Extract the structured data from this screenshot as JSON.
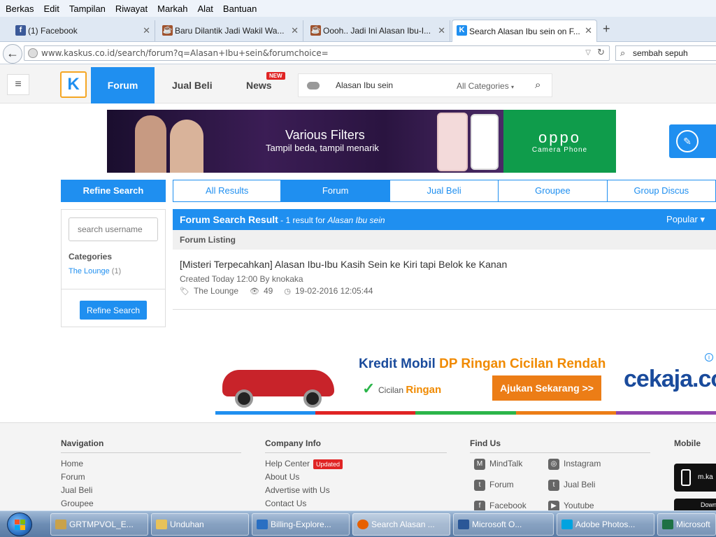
{
  "menu": [
    "Berkas",
    "Edit",
    "Tampilan",
    "Riwayat",
    "Markah",
    "Alat",
    "Bantuan"
  ],
  "tabs": [
    {
      "label": "(1) Facebook",
      "icon": "facebook-icon",
      "color": "#3b5998"
    },
    {
      "label": "Baru Dilantik Jadi Wakil Wa...",
      "icon": "coffee-icon",
      "color": "#a0522d"
    },
    {
      "label": "Oooh.. Jadi Ini Alasan Ibu-I...",
      "icon": "coffee-icon",
      "color": "#a0522d"
    },
    {
      "label": "Search Alasan Ibu sein on F...",
      "icon": "kaskus-icon",
      "color": "#1f8ff0"
    }
  ],
  "newtab": "+",
  "url": "www.kaskus.co.id/search/forum?q=Alasan+Ibu+sein&forumchoice=",
  "browser_search": "sembah sepuh",
  "header": {
    "logo": "K",
    "nav_forum": "Forum",
    "nav_jualbeli": "Jual Beli",
    "nav_news": "News",
    "news_badge": "NEW",
    "search_query": "Alasan Ibu sein",
    "categories": "All Categories"
  },
  "banner": {
    "title": "Various Filters",
    "subtitle": "Tampil beda, tampil menarik",
    "brand": "oppo",
    "brand_sub": "Camera  Phone"
  },
  "sidebar": {
    "heading": "Refine Search",
    "username_placeholder": "search username",
    "categories_label": "Categories",
    "category_item": "The Lounge",
    "category_count": "(1)",
    "refine_button": "Refine Search"
  },
  "result_tabs": [
    "All Results",
    "Forum",
    "Jual Beli",
    "Groupee",
    "Group Discus"
  ],
  "results": {
    "head_title": "Forum Search Result",
    "head_count": " - 1 result for ",
    "head_query": "Alasan Ibu sein",
    "sort": "Popular",
    "listing_label": "Forum Listing",
    "item": {
      "title": "[Misteri Terpecahkan] Alasan Ibu-Ibu Kasih Sein ke Kiri tapi Belok ke Kanan",
      "meta": "Created Today 12:00 By knokaka",
      "category": "The Lounge",
      "views": "49",
      "date": "19-02-2016 12:05:44"
    }
  },
  "ad": {
    "headline_pre": "Kredit Mobil ",
    "headline_orange": "DP Ringan Cicilan Rendah",
    "cicilan": "Cicilan ",
    "ringan": "Ringan",
    "cta": "Ajukan Sekarang >>",
    "brand": "cekaja.com",
    "stripe_colors": [
      "#1f8ff0",
      "#e02424",
      "#2bb54a",
      "#ec7d16",
      "#8e44ad"
    ]
  },
  "footer": {
    "navigation": {
      "title": "Navigation",
      "items": [
        "Home",
        "Forum",
        "Jual Beli",
        "Groupee"
      ]
    },
    "company": {
      "title": "Company Info",
      "items": [
        "Help Center",
        "About Us",
        "Advertise with Us",
        "Contact Us"
      ],
      "updated_badge": "Updated"
    },
    "findus": {
      "title": "Find Us",
      "items": [
        "MindTalk",
        "Instagram",
        "Forum",
        "Jual Beli",
        "Facebook",
        "Youtube"
      ]
    },
    "mobile": {
      "title": "Mobile",
      "btn1": "m.ka",
      "btn2": "Down"
    }
  },
  "taskbar": [
    {
      "label": "GRTMPVOL_E...",
      "color": "#c9a24a"
    },
    {
      "label": "Unduhan",
      "color": "#e8c25a"
    },
    {
      "label": "Billing-Explore...",
      "color": "#2a6fc2"
    },
    {
      "label": "Search Alasan ...",
      "color": "#e66000"
    },
    {
      "label": "Microsoft O...",
      "color": "#2b5797"
    },
    {
      "label": "Adobe Photos...",
      "color": "#00a3e0"
    },
    {
      "label": "Microsoft",
      "color": "#1e7145"
    }
  ]
}
